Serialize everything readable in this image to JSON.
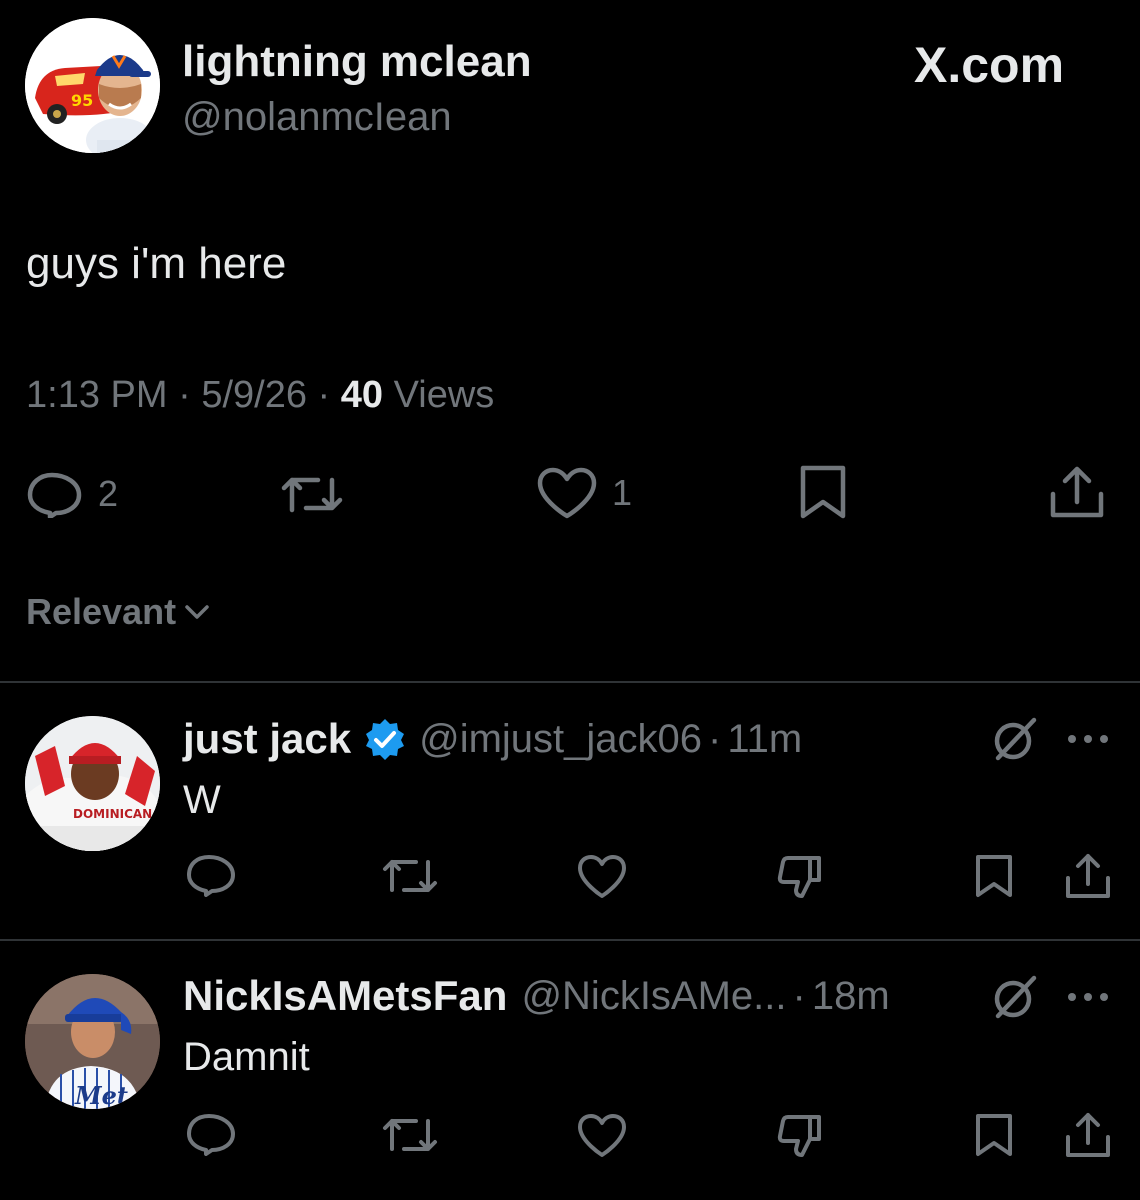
{
  "site": {
    "label": "X.com"
  },
  "post": {
    "author": {
      "name": "lightning mclean",
      "handle": "@nolanmcIean"
    },
    "text": "guys i'm here",
    "time": "1:13 PM",
    "date": "5/9/26",
    "views_count": "40",
    "views_label": "Views",
    "separator": "·",
    "actions": {
      "replies": "2",
      "likes": "1"
    }
  },
  "sort": {
    "label": "Relevant"
  },
  "replies": [
    {
      "name": "just jack",
      "verified": true,
      "handle": "@imjust_jack06",
      "age": "11m",
      "text": "W"
    },
    {
      "name": "NickIsAMetsFan",
      "verified": false,
      "handle": "@NickIsAMe...",
      "age": "18m",
      "text": "Damnit"
    }
  ],
  "icons": {
    "reply": "reply-icon",
    "repost": "repost-icon",
    "like": "heart-icon",
    "dislike": "dislike-icon",
    "bookmark": "bookmark-icon",
    "share": "share-icon",
    "grok": "grok-icon",
    "more": "more-icon",
    "chevron": "chevron-down-icon",
    "verified": "verified-badge-icon"
  },
  "colors": {
    "background": "#000000",
    "text_primary": "#e7e9ea",
    "text_secondary": "#71767b",
    "divider": "#2f3336",
    "verified": "#1d9bf0"
  }
}
